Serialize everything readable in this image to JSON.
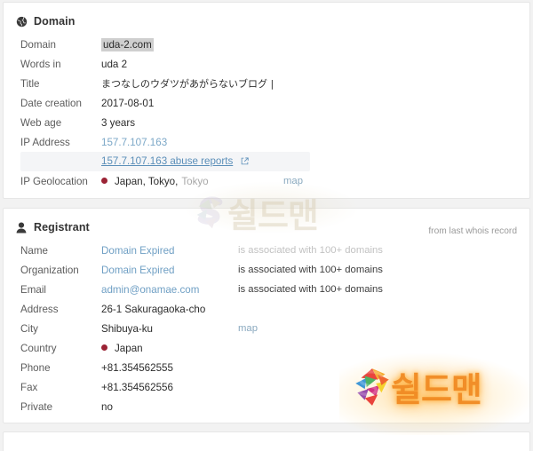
{
  "domain_panel": {
    "title": "Domain",
    "icon": "globe-icon",
    "rows": [
      {
        "label": "Domain",
        "value": "uda-2.com"
      },
      {
        "label": "Words in",
        "value": "uda 2"
      },
      {
        "label": "Title",
        "value": "まつなしのウダツがあがらないブログ |"
      },
      {
        "label": "Date creation",
        "value": "2017-08-01"
      },
      {
        "label": "Web age",
        "value": "3 years"
      },
      {
        "label": "IP Address",
        "value": "157.7.107.163"
      },
      {
        "label": "",
        "value": "157.7.107.163 abuse reports"
      },
      {
        "label": "IP Geolocation",
        "value": "Japan, Tokyo,",
        "value_muted": "Tokyo",
        "map": "map"
      }
    ]
  },
  "registrant_panel": {
    "title": "Registrant",
    "icon": "person-icon",
    "note": "from last whois record",
    "rows": [
      {
        "label": "Name",
        "value": "Domain Expired",
        "assoc": "is associated with 100+ domains"
      },
      {
        "label": "Organization",
        "value": "Domain Expired",
        "assoc": "is associated with 100+ domains"
      },
      {
        "label": "Email",
        "value": "admin@onamae.com",
        "assoc": "is associated with 100+ domains"
      },
      {
        "label": "Address",
        "value": "26-1 Sakuragaoka-cho"
      },
      {
        "label": "City",
        "value": "Shibuya-ku",
        "map": "map"
      },
      {
        "label": "Country",
        "value": "Japan"
      },
      {
        "label": "Phone",
        "value": "+81.354562555"
      },
      {
        "label": "Fax",
        "value": "+81.354562556"
      },
      {
        "label": "Private",
        "value": "no"
      }
    ]
  },
  "watermark": {
    "top_text": "쉴드맨",
    "bottom_text": "쉴드맨",
    "logo": "s-shield-logo"
  },
  "colors": {
    "link": "#7ba7c7",
    "label": "#5c5c5c",
    "value": "#2b2b2b",
    "dot": "#9b2335",
    "stripe": "#f4f5f7",
    "highlight": "#cfcfcf",
    "watermark_orange": "#f0861a"
  }
}
